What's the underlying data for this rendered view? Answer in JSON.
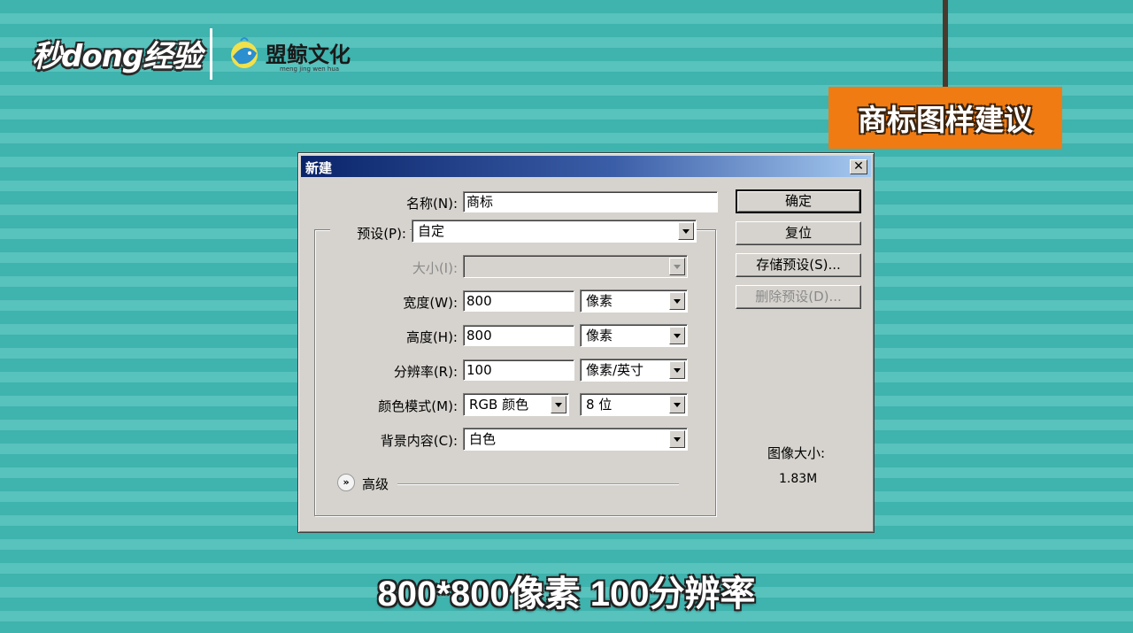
{
  "branding": {
    "main_logo": "秒dong经验",
    "partner_logo": "盟鲸文化",
    "partner_url": "meng jing wen hua"
  },
  "sign": {
    "text": "商标图样建议"
  },
  "dialog": {
    "title": "新建",
    "close_label": "✕",
    "fields": {
      "name": {
        "label": "名称(N):",
        "value": "商标"
      },
      "preset": {
        "label": "预设(P):",
        "value": "自定"
      },
      "size": {
        "label": "大小(I):",
        "value": ""
      },
      "width": {
        "label": "宽度(W):",
        "value": "800",
        "unit": "像素"
      },
      "height": {
        "label": "高度(H):",
        "value": "800",
        "unit": "像素"
      },
      "resolution": {
        "label": "分辨率(R):",
        "value": "100",
        "unit": "像素/英寸"
      },
      "color_mode": {
        "label": "颜色模式(M):",
        "value": "RGB 颜色",
        "depth": "8 位"
      },
      "background": {
        "label": "背景内容(C):",
        "value": "白色"
      }
    },
    "buttons": {
      "ok": "确定",
      "reset": "复位",
      "save_preset": "存储预设(S)...",
      "delete_preset": "删除预设(D)..."
    },
    "advanced": {
      "icon": "»",
      "label": "高级"
    },
    "image_size": {
      "label": "图像大小:",
      "value": "1.83M"
    }
  },
  "caption": "800*800像素 100分辨率",
  "colors": {
    "background_stripe_dark": "#3fb3ae",
    "background_stripe_light": "#58c2bd",
    "sign_orange": "#f07b12",
    "title_bar_start": "#0a246a",
    "title_bar_end": "#a6caf0"
  }
}
